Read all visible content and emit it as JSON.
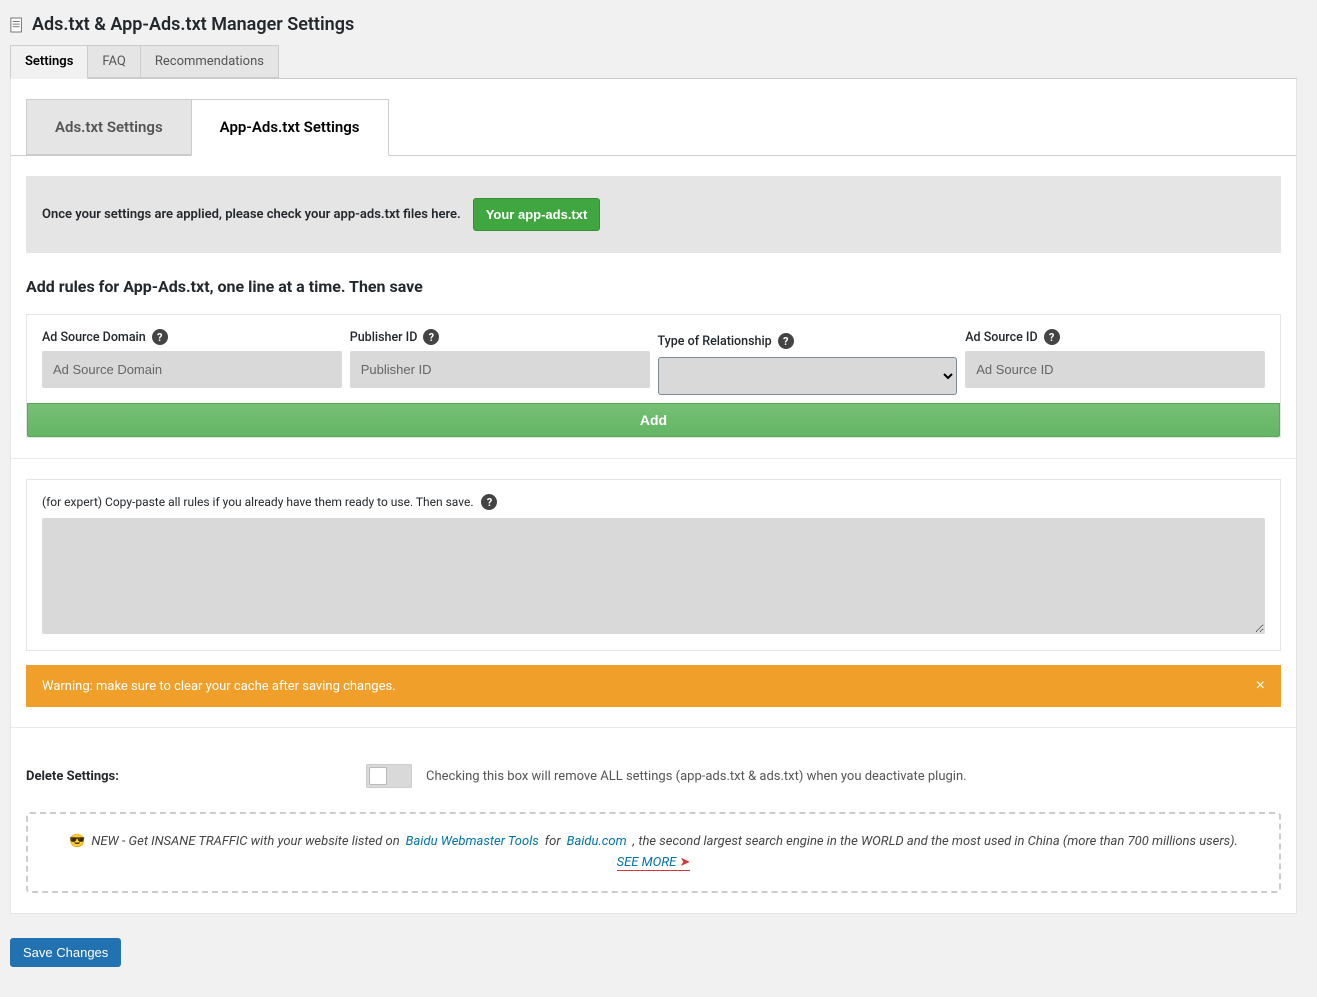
{
  "header": {
    "title": "Ads.txt & App-Ads.txt Manager Settings"
  },
  "outer_tabs": {
    "settings": "Settings",
    "faq": "FAQ",
    "recommendations": "Recommendations"
  },
  "inner_tabs": {
    "ads": "Ads.txt Settings",
    "app_ads": "App-Ads.txt Settings"
  },
  "check_notice": {
    "text": "Once your settings are applied, please check your app-ads.txt files here.",
    "button": "Your app-ads.txt"
  },
  "section_heading": "Add rules for App-Ads.txt, one line at a time. Then save",
  "form": {
    "ad_source_domain": {
      "label": "Ad Source Domain",
      "placeholder": "Ad Source Domain"
    },
    "publisher_id": {
      "label": "Publisher ID",
      "placeholder": "Publisher ID"
    },
    "relationship": {
      "label": "Type of Relationship"
    },
    "ad_source_id": {
      "label": "Ad Source ID",
      "placeholder": "Ad Source ID"
    },
    "add_button": "Add"
  },
  "expert": {
    "label": "(for expert) Copy-paste all rules if you already have them ready to use. Then save."
  },
  "warning": {
    "text": "Warning: make sure to clear your cache after saving changes."
  },
  "delete": {
    "label": "Delete Settings:",
    "description": "Checking this box will remove ALL settings (app-ads.txt & ads.txt) when you deactivate plugin."
  },
  "promo": {
    "lead": "NEW - Get INSANE TRAFFIC with your website listed on",
    "link1": "Baidu Webmaster Tools",
    "mid": "for",
    "link2": "Baidu.com",
    "trail": ", the second largest search engine in the WORLD and the most used in China (more than 700 millions users).",
    "see_more": "SEE MORE"
  },
  "save_button": "Save Changes"
}
